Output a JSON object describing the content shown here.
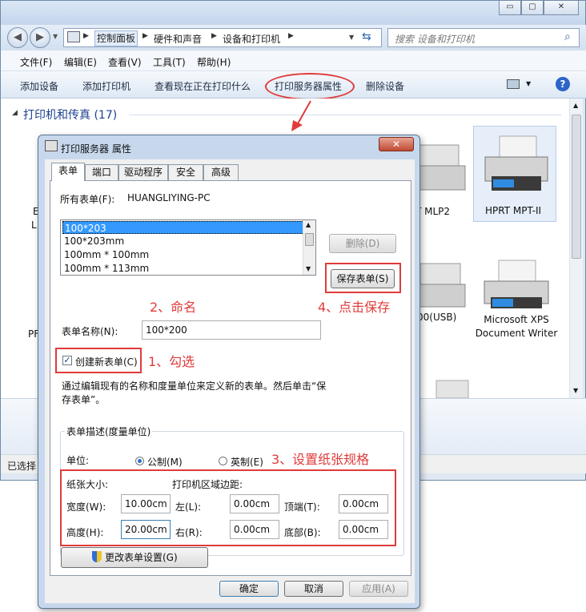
{
  "explorer": {
    "window_controls": [
      "▭",
      "▢",
      "✕"
    ],
    "breadcrumbs": [
      "控制面板",
      "硬件和声音",
      "设备和打印机"
    ],
    "search_placeholder": "搜索 设备和打印机",
    "menu": [
      "文件(F)",
      "编辑(E)",
      "查看(V)",
      "工具(T)",
      "帮助(H)"
    ],
    "commands": [
      "添加设备",
      "添加打印机",
      "查看现在正在打印什么",
      "打印服务器属性",
      "删除设备"
    ],
    "group_title": "打印机和传真 (17)",
    "printers": [
      {
        "label": "T MLP2"
      },
      {
        "label": "HPRT MPT-II"
      },
      {
        "label": "00(USB)"
      },
      {
        "label": "Microsoft XPS Document Writer"
      }
    ],
    "partial_labels": [
      "E",
      "L",
      "PF"
    ],
    "status": "已选择"
  },
  "dialog": {
    "title": "打印服务器 属性",
    "close": "✕",
    "tabs": [
      "表单",
      "端口",
      "驱动程序",
      "安全",
      "高级"
    ],
    "all_forms_label": "所有表单(F):",
    "server_name": "HUANGLIYING-PC",
    "forms_list": [
      "100*203",
      "100*203mm",
      "100mm * 100mm",
      "100mm * 113mm"
    ],
    "delete_button": "删除(D)",
    "save_button": "保存表单(S)",
    "form_name_label": "表单名称(N):",
    "form_name_value": "100*200",
    "create_new_label": "创建新表单(C)",
    "create_new_checked": true,
    "description": "通过编辑现有的名称和度量单位来定义新的表单。然后单击“保存表单”。",
    "desc_group_title": "表单描述(度量单位)",
    "units_label": "单位:",
    "unit_metric": "公制(M)",
    "unit_imperial": "英制(E)",
    "paper_size_label": "纸张大小:",
    "margins_label": "打印机区域边距:",
    "width_label": "宽度(W):",
    "width_value": "10.00cm",
    "height_label": "高度(H):",
    "height_value": "20.00cm",
    "left_label": "左(L):",
    "left_value": "0.00cm",
    "right_label": "右(R):",
    "right_value": "0.00cm",
    "top_label": "顶端(T):",
    "top_value": "0.00cm",
    "bottom_label": "底部(B):",
    "bottom_value": "0.00cm",
    "change_settings_button": "更改表单设置(G)",
    "ok_button": "确定",
    "cancel_button": "取消",
    "apply_button": "应用(A)"
  },
  "annotations": {
    "step1": "1、勾选",
    "step2": "2、命名",
    "step3": "3、设置纸张规格",
    "step4": "4、点击保存",
    "accent_color": "#e03b3b"
  }
}
